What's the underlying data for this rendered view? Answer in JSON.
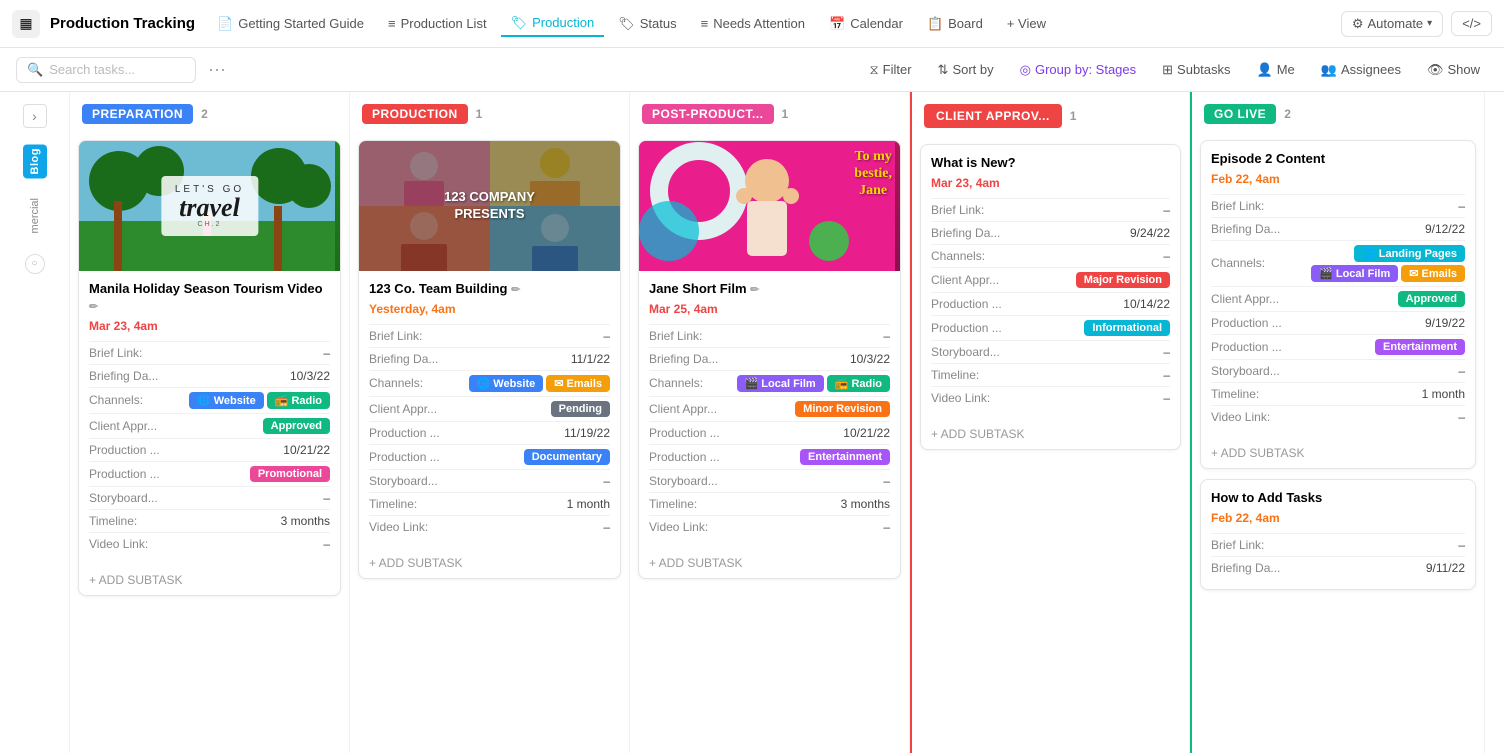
{
  "app": {
    "logo": "▦",
    "title": "Production Tracking"
  },
  "nav": {
    "tabs": [
      {
        "id": "getting-started",
        "label": "Getting Started Guide",
        "icon": "📄",
        "active": false
      },
      {
        "id": "production-list",
        "label": "Production List",
        "icon": "≡",
        "active": false
      },
      {
        "id": "production",
        "label": "Production",
        "icon": "🏷",
        "active": true
      },
      {
        "id": "status",
        "label": "Status",
        "icon": "🏷",
        "active": false
      },
      {
        "id": "needs-attention",
        "label": "Needs Attention",
        "icon": "≡",
        "active": false
      },
      {
        "id": "calendar",
        "label": "Calendar",
        "icon": "📅",
        "active": false
      },
      {
        "id": "board",
        "label": "Board",
        "icon": "📋",
        "active": false
      },
      {
        "id": "view",
        "label": "+ View",
        "icon": "",
        "active": false
      }
    ],
    "right": {
      "automate_label": "Automate",
      "share_icon": "⟨⟩"
    }
  },
  "toolbar": {
    "search_placeholder": "Search tasks...",
    "filter_label": "Filter",
    "sort_label": "Sort by",
    "group_label": "Group by: Stages",
    "subtasks_label": "Subtasks",
    "me_label": "Me",
    "assignees_label": "Assignees",
    "show_label": "Show"
  },
  "columns": [
    {
      "id": "left-sidebar",
      "collapsed": true,
      "items": [
        {
          "label": "Blog",
          "color": "#0ea5e9"
        },
        {
          "label": "mercial",
          "color": "#888"
        }
      ]
    },
    {
      "id": "preparation",
      "label": "PREPARATION",
      "color": "#3b82f6",
      "count": 2,
      "cards": [
        {
          "id": "manila",
          "image_type": "travel",
          "title": "Manila Holiday Season Tourism Video",
          "has_link_icon": true,
          "date": "Mar 23, 4am",
          "date_color": "#ef4444",
          "fields": [
            {
              "label": "Brief Link:",
              "value": "–"
            },
            {
              "label": "Briefing Da...",
              "value": "10/3/22"
            },
            {
              "label": "Channels:",
              "badges": [
                {
                  "text": "Website",
                  "class": "badge-website",
                  "icon": "🌐"
                },
                {
                  "text": "Radio",
                  "class": "badge-radio",
                  "icon": "📻"
                }
              ]
            },
            {
              "label": "Client Appr...",
              "badges": [
                {
                  "text": "Approved",
                  "class": "badge-approved"
                }
              ]
            },
            {
              "label": "Production ...",
              "value": "10/21/22"
            },
            {
              "label": "Production ...",
              "badges": [
                {
                  "text": "Promotional",
                  "class": "badge-promotional"
                }
              ]
            },
            {
              "label": "Storyboard...",
              "value": "–"
            },
            {
              "label": "Timeline:",
              "value": "3 months"
            },
            {
              "label": "Video Link:",
              "value": "–"
            }
          ],
          "add_subtask": "+ ADD SUBTASK"
        }
      ]
    },
    {
      "id": "production",
      "label": "PRODUCTION",
      "color": "#ef4444",
      "count": 1,
      "cards": [
        {
          "id": "123company",
          "image_type": "company",
          "title": "123 Co. Team Building",
          "has_link_icon": true,
          "date": "Yesterday, 4am",
          "date_color": "#f97316",
          "fields": [
            {
              "label": "Brief Link:",
              "value": "–"
            },
            {
              "label": "Briefing Da...",
              "value": "11/1/22"
            },
            {
              "label": "Channels:",
              "badges": [
                {
                  "text": "Website",
                  "class": "badge-website",
                  "icon": "🌐"
                },
                {
                  "text": "Emails",
                  "class": "badge-emails",
                  "icon": "✉️"
                }
              ]
            },
            {
              "label": "Client Appr...",
              "badges": [
                {
                  "text": "Pending",
                  "class": "badge-pending"
                }
              ]
            },
            {
              "label": "Production ...",
              "value": "11/19/22"
            },
            {
              "label": "Production ...",
              "badges": [
                {
                  "text": "Documentary",
                  "class": "badge-documentary"
                }
              ]
            },
            {
              "label": "Storyboard...",
              "value": "–"
            },
            {
              "label": "Timeline:",
              "value": "1 month"
            },
            {
              "label": "Video Link:",
              "value": "–"
            }
          ],
          "add_subtask": "+ ADD SUBTASK"
        }
      ]
    },
    {
      "id": "post-production",
      "label": "POST-PRODUCT...",
      "color": "#ec4899",
      "count": 1,
      "cards": [
        {
          "id": "jane",
          "image_type": "jane",
          "title": "Jane Short Film",
          "has_link_icon": true,
          "date": "Mar 25, 4am",
          "date_color": "#ef4444",
          "fields": [
            {
              "label": "Brief Link:",
              "value": "–"
            },
            {
              "label": "Briefing Da...",
              "value": "10/3/22"
            },
            {
              "label": "Channels:",
              "badges": [
                {
                  "text": "Local Film",
                  "class": "badge-localfilm",
                  "icon": "🎬"
                },
                {
                  "text": "Radio",
                  "class": "badge-radio",
                  "icon": "📻"
                }
              ]
            },
            {
              "label": "Client Appr...",
              "badges": [
                {
                  "text": "Minor Revision",
                  "class": "badge-minor-revision"
                }
              ]
            },
            {
              "label": "Production ...",
              "value": "10/21/22"
            },
            {
              "label": "Production ...",
              "badges": [
                {
                  "text": "Entertainment",
                  "class": "badge-entertainment"
                }
              ]
            },
            {
              "label": "Storyboard...",
              "value": "–"
            },
            {
              "label": "Timeline:",
              "value": "3 months"
            },
            {
              "label": "Video Link:",
              "value": "–"
            }
          ],
          "add_subtask": "+ ADD SUBTASK"
        }
      ]
    },
    {
      "id": "client-approval",
      "label": "CLIENT APPROV...",
      "color": "#ef4444",
      "count": 1,
      "cards": [
        {
          "id": "whatsnew",
          "image_type": "none",
          "title": "What is New?",
          "has_link_icon": false,
          "date": "Mar 23, 4am",
          "date_color": "#ef4444",
          "fields": [
            {
              "label": "Brief Link:",
              "value": "–"
            },
            {
              "label": "Briefing Da...",
              "value": "9/24/22"
            },
            {
              "label": "Channels:",
              "value": "–"
            },
            {
              "label": "Client Appr...",
              "badges": [
                {
                  "text": "Major Revision",
                  "class": "badge-major-revision"
                }
              ]
            },
            {
              "label": "Production ...",
              "value": "10/14/22"
            },
            {
              "label": "Production ...",
              "badges": [
                {
                  "text": "Informational",
                  "class": "badge-informational"
                }
              ]
            },
            {
              "label": "Storyboard...",
              "value": "–"
            },
            {
              "label": "Timeline:",
              "value": "–"
            },
            {
              "label": "Video Link:",
              "value": "–"
            }
          ],
          "add_subtask": "+ ADD SUBTASK"
        }
      ]
    },
    {
      "id": "golive",
      "label": "GO LIVE",
      "color": "#10b981",
      "count": 2,
      "cards": [
        {
          "id": "episode2",
          "image_type": "none",
          "title": "Episode 2 Content",
          "has_link_icon": false,
          "date": "Feb 22, 4am",
          "date_color": "#f97316",
          "fields": [
            {
              "label": "Brief Link:",
              "value": "–"
            },
            {
              "label": "Briefing Da...",
              "value": "9/12/22"
            },
            {
              "label": "Channels:",
              "badges": [
                {
                  "text": "Landing Pages",
                  "class": "badge-landing-pages",
                  "icon": "🌐"
                },
                {
                  "text": "Local Film",
                  "class": "badge-localfilm",
                  "icon": "🎬"
                },
                {
                  "text": "Emails",
                  "class": "badge-emails",
                  "icon": "✉️"
                }
              ]
            },
            {
              "label": "Client Appr...",
              "badges": [
                {
                  "text": "Approved",
                  "class": "badge-approved"
                }
              ]
            },
            {
              "label": "Production ...",
              "value": "9/19/22"
            },
            {
              "label": "Production ...",
              "badges": [
                {
                  "text": "Entertainment",
                  "class": "badge-entertainment"
                }
              ]
            },
            {
              "label": "Storyboard...",
              "value": "–"
            },
            {
              "label": "Timeline:",
              "value": "1 month"
            },
            {
              "label": "Video Link:",
              "value": "–"
            }
          ],
          "add_subtask": "+ ADD SUBTASK"
        },
        {
          "id": "howto",
          "image_type": "none",
          "title": "How to Add Tasks",
          "has_link_icon": false,
          "date": "Feb 22, 4am",
          "date_color": "#f97316",
          "fields": [
            {
              "label": "Brief Link:",
              "value": "–"
            },
            {
              "label": "Briefing Da...",
              "value": "9/11/22"
            }
          ],
          "add_subtask": ""
        }
      ]
    }
  ],
  "labels": {
    "add_subtask": "+ ADD SUBTASK",
    "dash": "–"
  }
}
